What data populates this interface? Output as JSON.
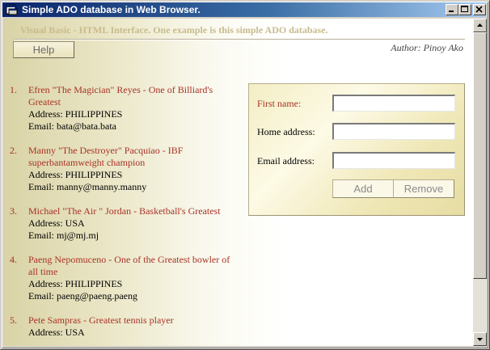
{
  "window": {
    "title": "Simple ADO database in Web Browser."
  },
  "page": {
    "heading": "Visual Basic - HTML Interface. One example is this simple ADO database.",
    "help_label": "Help",
    "author": "Author: Pinoy Ako"
  },
  "records": [
    {
      "num": "1.",
      "name": "Efren \"The Magician\" Reyes - One of Billiard's Greatest",
      "address": "Address: PHILIPPINES",
      "email": "Email: bata@bata.bata"
    },
    {
      "num": "2.",
      "name": "Manny \"The Destroyer\" Pacquiao - IBF superbantamweight champion",
      "address": "Address: PHILIPPINES",
      "email": "Email: manny@manny.manny"
    },
    {
      "num": "3.",
      "name": "Michael \"The Air \" Jordan - Basketball's Greatest",
      "address": "Address: USA",
      "email": "Email: mj@mj.mj"
    },
    {
      "num": "4.",
      "name": "Paeng Nepomuceno - One of the Greatest bowler of all time",
      "address": "Address: PHILIPPINES",
      "email": "Email: paeng@paeng.paeng"
    },
    {
      "num": "5.",
      "name": "Pete Sampras - Greatest tennis player",
      "address": "Address: USA",
      "email": ""
    }
  ],
  "form": {
    "first_name_label": "First name:",
    "first_name_value": "",
    "home_address_label": "Home address:",
    "home_address_value": "",
    "email_label": "Email address:",
    "email_value": "",
    "add_label": "Add",
    "remove_label": "Remove"
  },
  "colors": {
    "titlebar_start": "#0a246a",
    "record_name": "#a83226",
    "heading": "#c8bb8c"
  }
}
